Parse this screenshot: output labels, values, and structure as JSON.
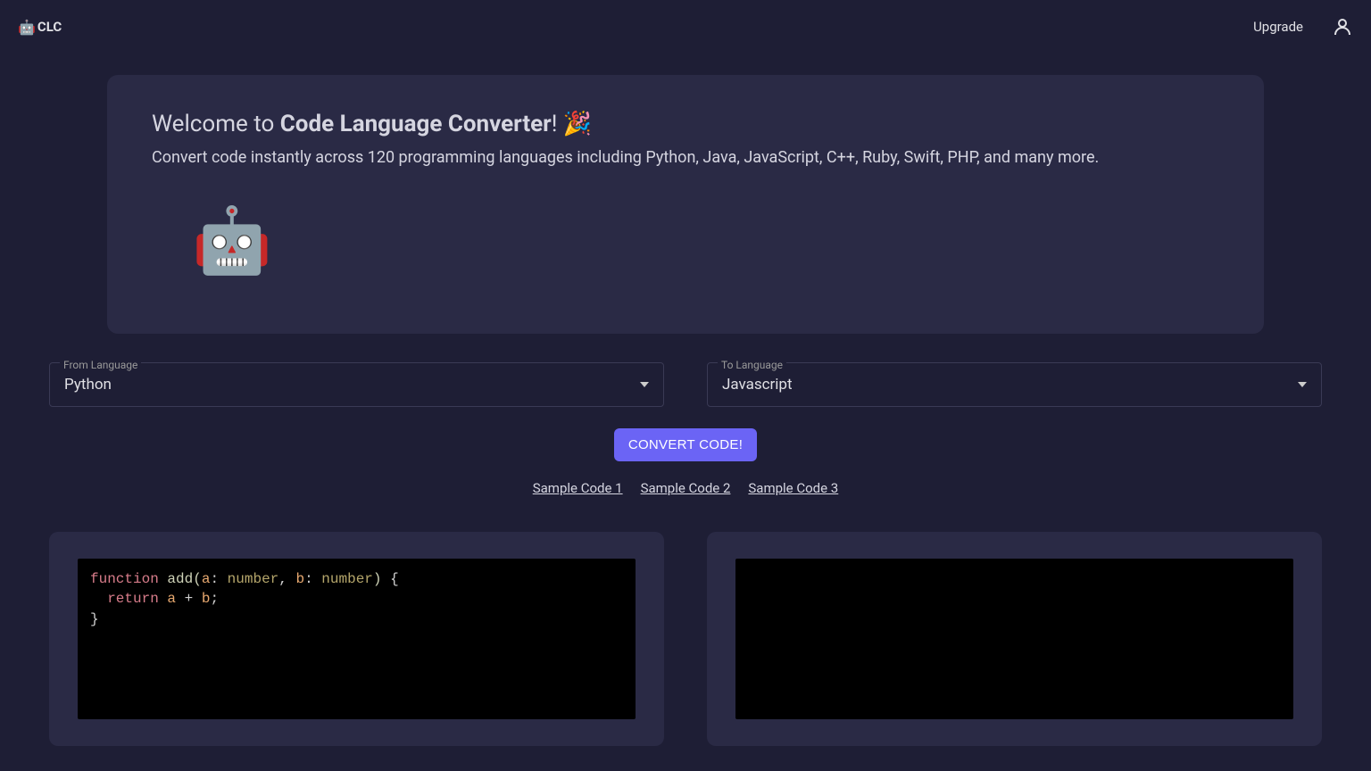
{
  "header": {
    "logo_emoji": "🤖",
    "logo_text": "CLC",
    "upgrade_label": "Upgrade"
  },
  "welcome": {
    "title_prefix": "Welcome to ",
    "title_bold": "Code Language Converter",
    "title_suffix": "! 🎉",
    "subtitle": "Convert code instantly across 120 programming languages including Python, Java, JavaScript, C++, Ruby, Swift, PHP, and many more.",
    "robot_emoji": "🤖"
  },
  "selectors": {
    "from_label": "From Language",
    "from_value": "Python",
    "to_label": "To Language",
    "to_value": "Javascript"
  },
  "convert": {
    "button_label": "CONVERT CODE!"
  },
  "samples": [
    "Sample Code 1",
    "Sample Code 2",
    "Sample Code 3"
  ],
  "code": {
    "input_tokens": [
      {
        "cls": "tok-keyword",
        "t": "function"
      },
      {
        "cls": "",
        "t": " "
      },
      {
        "cls": "tok-name",
        "t": "add"
      },
      {
        "cls": "tok-paren",
        "t": "("
      },
      {
        "cls": "tok-param",
        "t": "a"
      },
      {
        "cls": "tok-punct",
        "t": ": "
      },
      {
        "cls": "tok-type",
        "t": "number"
      },
      {
        "cls": "tok-punct",
        "t": ", "
      },
      {
        "cls": "tok-param",
        "t": "b"
      },
      {
        "cls": "tok-punct",
        "t": ": "
      },
      {
        "cls": "tok-type",
        "t": "number"
      },
      {
        "cls": "tok-paren",
        "t": ")"
      },
      {
        "cls": "",
        "t": " "
      },
      {
        "cls": "tok-punct",
        "t": "{"
      },
      {
        "cls": "",
        "t": "\n  "
      },
      {
        "cls": "tok-return",
        "t": "return"
      },
      {
        "cls": "",
        "t": " "
      },
      {
        "cls": "tok-param",
        "t": "a"
      },
      {
        "cls": "",
        "t": " "
      },
      {
        "cls": "tok-op",
        "t": "+"
      },
      {
        "cls": "",
        "t": " "
      },
      {
        "cls": "tok-param",
        "t": "b"
      },
      {
        "cls": "tok-punct",
        "t": ";"
      },
      {
        "cls": "",
        "t": "\n"
      },
      {
        "cls": "tok-punct",
        "t": "}"
      }
    ],
    "output": ""
  }
}
